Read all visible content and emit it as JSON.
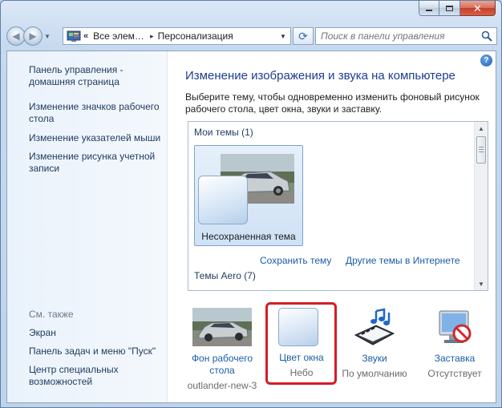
{
  "window": {
    "close_glyph": "✕"
  },
  "navbar": {
    "back_glyph": "◀",
    "forward_glyph": "▶",
    "address_chevron": "«",
    "address_segments": [
      "Все элементы панели управления",
      "Персонализация"
    ],
    "address_sep_glyph": "▸",
    "dropdown_glyph": "▼",
    "refresh_glyph": "⟳",
    "search_placeholder": "Поиск в панели управления",
    "icon": "control-panel-icon"
  },
  "sidebar": {
    "items": [
      {
        "label": "Панель управления - домашняя страница"
      },
      {
        "label": "Изменение значков рабочего стола"
      },
      {
        "label": "Изменение указателей мыши"
      },
      {
        "label": "Изменение рисунка учетной записи"
      }
    ],
    "see_also_heading": "См. также",
    "see_also": [
      {
        "label": "Экран"
      },
      {
        "label": "Панель задач и меню \"Пуск\""
      },
      {
        "label": "Центр специальных возможностей"
      }
    ]
  },
  "main": {
    "help_glyph": "?",
    "title": "Изменение изображения и звука на компьютере",
    "description": "Выберите тему, чтобы одновременно изменить фоновый рисунок рабочего стола, цвет окна, звуки и заставку.",
    "my_themes_label": "Мои темы (1)",
    "theme_tile_label": "Несохраненная тема",
    "save_theme_link": "Сохранить тему",
    "more_themes_link": "Другие темы в Интернете",
    "aero_themes_label": "Темы Aero (7)",
    "scroll_up_glyph": "▲",
    "scroll_down_glyph": "▼"
  },
  "bottom": [
    {
      "title": "Фон рабочего стола",
      "value": "outlander-new-3",
      "icon": "car-wallpaper-icon"
    },
    {
      "title": "Цвет окна",
      "value": "Небо",
      "icon": "window-color-icon"
    },
    {
      "title": "Звуки",
      "value": "По умолчанию",
      "icon": "sounds-icon"
    },
    {
      "title": "Заставка",
      "value": "Отсутствует",
      "icon": "screensaver-icon"
    }
  ],
  "colors": {
    "accent": "#1e3d8f",
    "link": "#1a5da8",
    "highlight": "#d51c24"
  }
}
